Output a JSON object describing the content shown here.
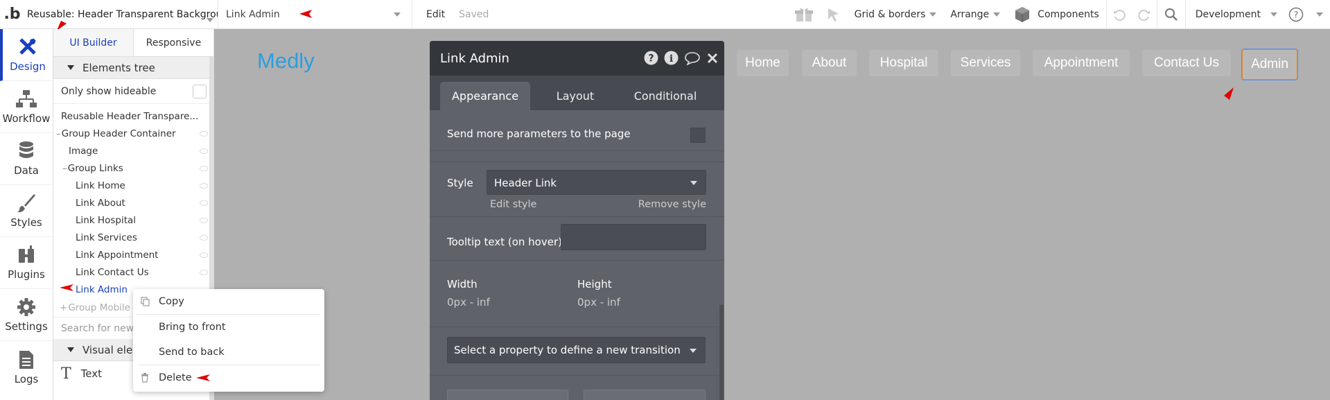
{
  "topbar": {
    "logo": ".b",
    "page_selector": "Reusable: Header Transparent Backgrou",
    "element_selector": "Link Admin",
    "edit_label": "Edit",
    "saved_label": "Saved",
    "grid_borders": "Grid & borders",
    "arrange": "Arrange",
    "components": "Components",
    "environment": "Development"
  },
  "sidenav": [
    {
      "label": "Design",
      "icon": "design-icon"
    },
    {
      "label": "Workflow",
      "icon": "workflow-icon"
    },
    {
      "label": "Data",
      "icon": "database-icon"
    },
    {
      "label": "Styles",
      "icon": "brush-icon"
    },
    {
      "label": "Plugins",
      "icon": "plug-icon"
    },
    {
      "label": "Settings",
      "icon": "gear-icon"
    },
    {
      "label": "Logs",
      "icon": "document-icon"
    }
  ],
  "tree": {
    "tab_ui_builder": "UI Builder",
    "tab_responsive": "Responsive",
    "elements_tree": "Elements tree",
    "only_show_hideable": "Only show hideable",
    "items": [
      {
        "label": "Reusable Header Transpare..."
      },
      {
        "label": "Group Header Container"
      },
      {
        "label": "Image"
      },
      {
        "label": "Group Links"
      },
      {
        "label": "Link Home"
      },
      {
        "label": "Link About"
      },
      {
        "label": "Link Hospital"
      },
      {
        "label": "Link Services"
      },
      {
        "label": "Link Appointment"
      },
      {
        "label": "Link Contact Us"
      },
      {
        "label": "Link Admin"
      },
      {
        "label": "Group Mobile"
      }
    ],
    "search_placeholder": "Search for new",
    "visual_elements": "Visual ele",
    "text_item": "Text"
  },
  "canvas": {
    "brand": "Medly",
    "nav": [
      "Home",
      "About",
      "Hospital",
      "Services",
      "Appointment",
      "Contact Us",
      "Admin"
    ]
  },
  "panel": {
    "title": "Link Admin",
    "tabs": [
      "Appearance",
      "Layout",
      "Conditional"
    ],
    "send_params": "Send more parameters to the page",
    "style_label": "Style",
    "style_value": "Header Link",
    "edit_style": "Edit style",
    "remove_style": "Remove style",
    "tooltip_label": "Tooltip text (on hover)",
    "width_label": "Width",
    "width_value": "0px - inf",
    "height_label": "Height",
    "height_value": "0px - inf",
    "transition_select": "Select a property to define a new transition"
  },
  "context_menu": {
    "copy": "Copy",
    "bring_front": "Bring to front",
    "send_back": "Send to back",
    "delete": "Delete"
  },
  "colors": {
    "accent_blue": "#1a3fbf",
    "brand_blue": "#2a9ee0",
    "arrow_red": "#e00000",
    "panel_bg": "#5f6369",
    "panel_header": "#33373c",
    "canvas_bg": "#b0b0b0"
  }
}
